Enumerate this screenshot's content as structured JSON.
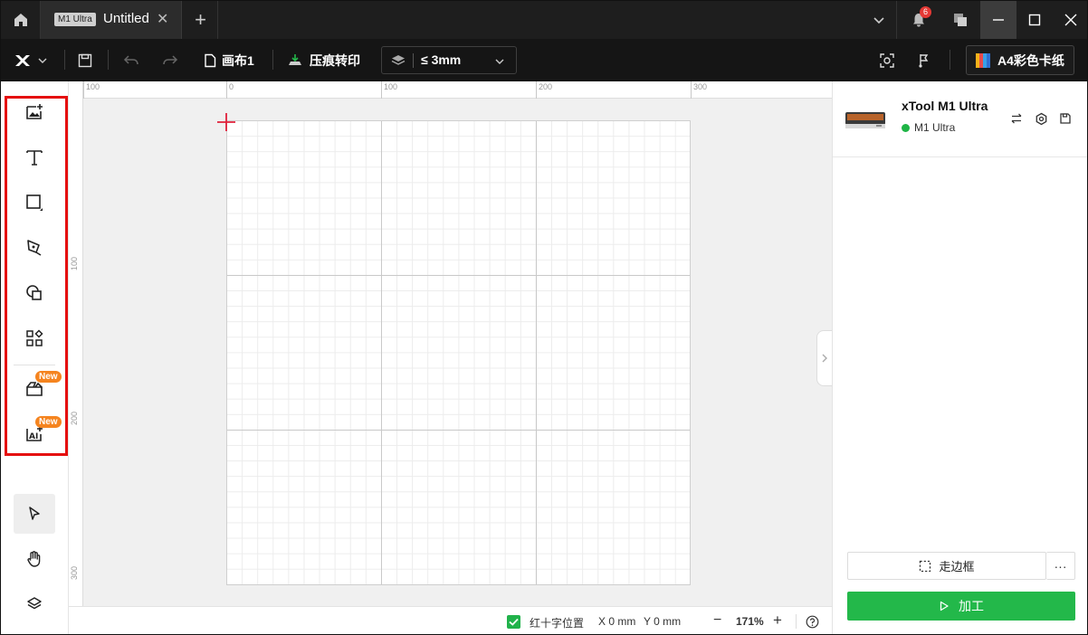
{
  "titlebar": {
    "tab_badge": "M1 Ultra",
    "tab_title": "Untitled",
    "tab_close": "✕",
    "tab_add": "+",
    "notification_count": "6"
  },
  "toolbar": {
    "canvas_label": "画布1",
    "emboss_label": "压痕转印",
    "layer_value": "≤ 3mm",
    "material_label": "A4彩色卡纸"
  },
  "sidebar": {
    "badge_new_1": "New",
    "badge_new_2": "New"
  },
  "rulers": {
    "h_ticks": [
      "100",
      "0",
      "100",
      "200",
      "300"
    ],
    "v_ticks": [
      "100",
      "200",
      "300"
    ]
  },
  "statusbar": {
    "crosshair_label": "红十字位置",
    "x_label": "X 0 mm",
    "y_label": "Y 0 mm",
    "zoom_minus": "−",
    "zoom_value": "171%",
    "zoom_plus": "+"
  },
  "device": {
    "name": "xTool M1 Ultra",
    "model": "M1 Ultra",
    "status_color": "#1fb546"
  },
  "actions": {
    "frame_label": "走边框",
    "more_label": "···",
    "process_label": "加工"
  },
  "colors": {
    "accent_green": "#23b84a",
    "highlight_red": "#e50e0e",
    "badge_orange": "#f5841f"
  }
}
